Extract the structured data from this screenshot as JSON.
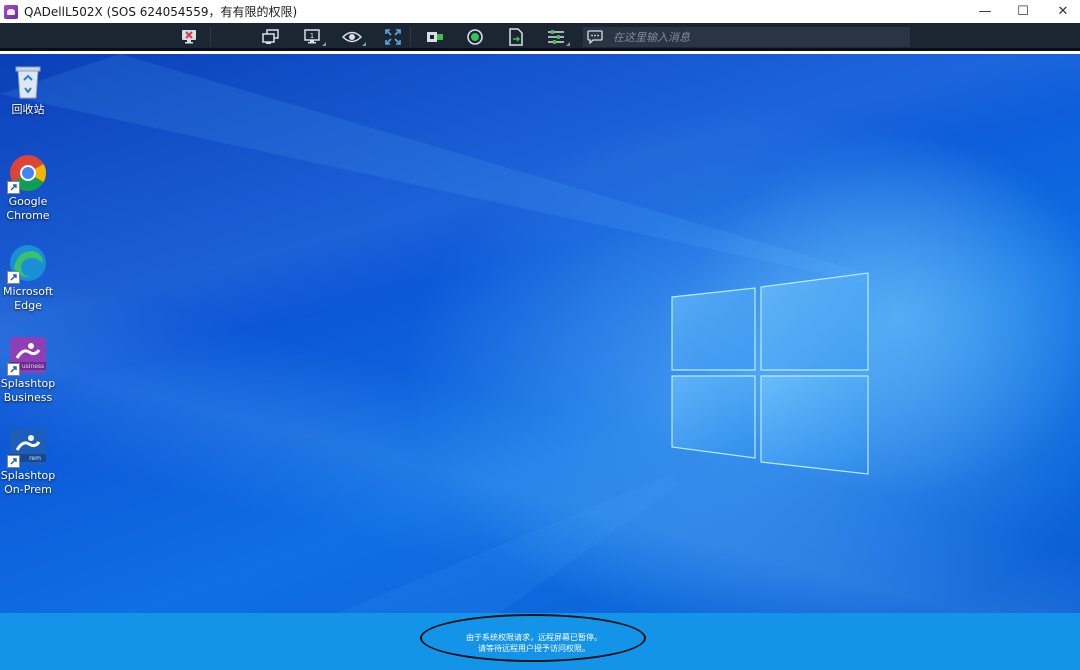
{
  "window": {
    "title": "QADellL502X (SOS 624054559，有有限的权限)",
    "controls": {
      "minimize": "—",
      "maximize": "☐",
      "close": "✕"
    }
  },
  "toolbar": {
    "buttons": [
      {
        "name": "disconnect-icon"
      },
      {
        "name": "multi-monitor-icon"
      },
      {
        "name": "monitor-1-icon",
        "badge": "1"
      },
      {
        "name": "view-eye-icon"
      },
      {
        "name": "fullscreen-icon"
      },
      {
        "name": "switch-session-icon"
      },
      {
        "name": "record-icon"
      },
      {
        "name": "file-transfer-icon"
      },
      {
        "name": "settings-sliders-icon"
      }
    ],
    "chat_placeholder": "在这里输入消息"
  },
  "desktop": {
    "icons": [
      {
        "id": "recycle-bin",
        "label": "回收站"
      },
      {
        "id": "chrome",
        "label_lines": [
          "Google",
          "Chrome"
        ]
      },
      {
        "id": "edge",
        "label_lines": [
          "Microsoft",
          "Edge"
        ]
      },
      {
        "id": "splashtop-business",
        "label_lines": [
          "Splashtop",
          "Business"
        ],
        "badge": "usiness"
      },
      {
        "id": "splashtop-onprem",
        "label_lines": [
          "Splashtop",
          "On-Prem"
        ],
        "badge": "rem"
      }
    ]
  },
  "notice": {
    "line1": "由于系统权限请求，远程屏幕已暂停。",
    "line2": "请等待远程用户授予访问权限。"
  },
  "colors": {
    "toolbar_bg": "#1c2633",
    "desktop_blue": "#0c55d6",
    "notice_bar": "#1494e8"
  }
}
